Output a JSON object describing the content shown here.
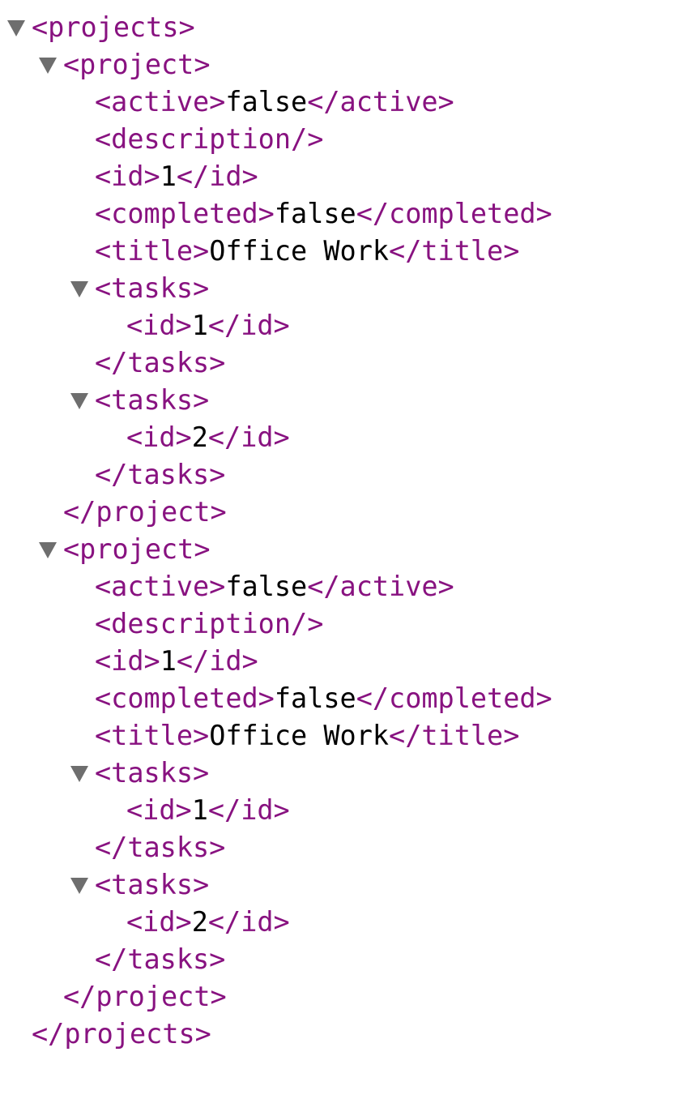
{
  "colors": {
    "tag": "#881280",
    "text": "#000000",
    "toggle": "#6e6e6e"
  },
  "lines": [
    {
      "indent": 0,
      "toggle": true,
      "open": "<projects>",
      "text": "",
      "close": "",
      "name": "projects-open"
    },
    {
      "indent": 1,
      "toggle": true,
      "open": "<project>",
      "text": "",
      "close": "",
      "name": "project-open"
    },
    {
      "indent": 2,
      "toggle": false,
      "open": "<active>",
      "text": "false",
      "close": "</active>",
      "name": "active-element"
    },
    {
      "indent": 2,
      "toggle": false,
      "open": "<description/>",
      "text": "",
      "close": "",
      "name": "description-element"
    },
    {
      "indent": 2,
      "toggle": false,
      "open": "<id>",
      "text": "1",
      "close": "</id>",
      "name": "id-element"
    },
    {
      "indent": 2,
      "toggle": false,
      "open": "<completed>",
      "text": "false",
      "close": "</completed>",
      "name": "completed-element"
    },
    {
      "indent": 2,
      "toggle": false,
      "open": "<title>",
      "text": "Office Work",
      "close": "</title>",
      "name": "title-element"
    },
    {
      "indent": 2,
      "toggle": true,
      "open": "<tasks>",
      "text": "",
      "close": "",
      "name": "tasks-open"
    },
    {
      "indent": 3,
      "toggle": false,
      "open": "<id>",
      "text": "1",
      "close": "</id>",
      "name": "task-id-element"
    },
    {
      "indent": 2,
      "toggle": false,
      "open": "</tasks>",
      "text": "",
      "close": "",
      "name": "tasks-close"
    },
    {
      "indent": 2,
      "toggle": true,
      "open": "<tasks>",
      "text": "",
      "close": "",
      "name": "tasks-open"
    },
    {
      "indent": 3,
      "toggle": false,
      "open": "<id>",
      "text": "2",
      "close": "</id>",
      "name": "task-id-element"
    },
    {
      "indent": 2,
      "toggle": false,
      "open": "</tasks>",
      "text": "",
      "close": "",
      "name": "tasks-close"
    },
    {
      "indent": 1,
      "toggle": false,
      "open": "</project>",
      "text": "",
      "close": "",
      "name": "project-close"
    },
    {
      "indent": 1,
      "toggle": true,
      "open": "<project>",
      "text": "",
      "close": "",
      "name": "project-open"
    },
    {
      "indent": 2,
      "toggle": false,
      "open": "<active>",
      "text": "false",
      "close": "</active>",
      "name": "active-element"
    },
    {
      "indent": 2,
      "toggle": false,
      "open": "<description/>",
      "text": "",
      "close": "",
      "name": "description-element"
    },
    {
      "indent": 2,
      "toggle": false,
      "open": "<id>",
      "text": "1",
      "close": "</id>",
      "name": "id-element"
    },
    {
      "indent": 2,
      "toggle": false,
      "open": "<completed>",
      "text": "false",
      "close": "</completed>",
      "name": "completed-element"
    },
    {
      "indent": 2,
      "toggle": false,
      "open": "<title>",
      "text": "Office Work",
      "close": "</title>",
      "name": "title-element"
    },
    {
      "indent": 2,
      "toggle": true,
      "open": "<tasks>",
      "text": "",
      "close": "",
      "name": "tasks-open"
    },
    {
      "indent": 3,
      "toggle": false,
      "open": "<id>",
      "text": "1",
      "close": "</id>",
      "name": "task-id-element"
    },
    {
      "indent": 2,
      "toggle": false,
      "open": "</tasks>",
      "text": "",
      "close": "",
      "name": "tasks-close"
    },
    {
      "indent": 2,
      "toggle": true,
      "open": "<tasks>",
      "text": "",
      "close": "",
      "name": "tasks-open"
    },
    {
      "indent": 3,
      "toggle": false,
      "open": "<id>",
      "text": "2",
      "close": "</id>",
      "name": "task-id-element"
    },
    {
      "indent": 2,
      "toggle": false,
      "open": "</tasks>",
      "text": "",
      "close": "",
      "name": "tasks-close"
    },
    {
      "indent": 1,
      "toggle": false,
      "open": "</project>",
      "text": "",
      "close": "",
      "name": "project-close"
    },
    {
      "indent": 0,
      "toggle": false,
      "open": "</projects>",
      "text": "",
      "close": "",
      "name": "projects-close"
    }
  ]
}
